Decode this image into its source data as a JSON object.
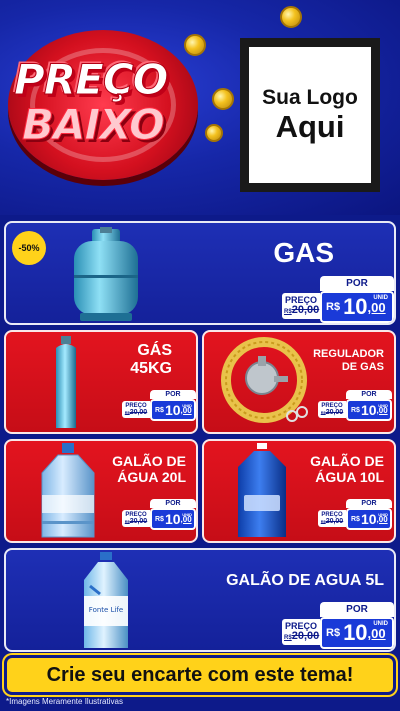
{
  "header": {
    "title_line1": "PREÇO",
    "title_line2": "BAIXO",
    "logo_line1": "Sua Logo",
    "logo_line2": "Aqui"
  },
  "colors": {
    "background": "#0d1a8a",
    "card_blue": "#1e2fb5",
    "card_red": "#e3141f",
    "accent_yellow": "#ffd21a",
    "price_blue": "#1a3ad8"
  },
  "products": [
    {
      "name": "GAS",
      "badge": "-50%",
      "old_label": "PREÇO",
      "old_price": "R$20,00",
      "old_cur": "R$",
      "old_val": "20,00",
      "por": "POR",
      "currency": "R$",
      "price_int": "10",
      "price_dec": ",00",
      "unit": "UNID",
      "icon": "gas-cylinder-icon"
    },
    {
      "name": "GÁS\n45KG",
      "old_label": "PREÇO",
      "old_cur": "R$",
      "old_val": "20,00",
      "por": "POR",
      "currency": "R$",
      "price_int": "10",
      "price_dec": ",00",
      "unit": "UNID",
      "icon": "tall-gas-cylinder-icon"
    },
    {
      "name": "REGULADOR\nDE GAS",
      "old_label": "PREÇO",
      "old_cur": "R$",
      "old_val": "20,00",
      "por": "POR",
      "currency": "R$",
      "price_int": "10",
      "price_dec": ",00",
      "unit": "UNID",
      "icon": "gas-regulator-icon"
    },
    {
      "name": "GALÃO DE\nÁGUA 20L",
      "old_label": "PREÇO",
      "old_cur": "R$",
      "old_val": "20,00",
      "por": "POR",
      "currency": "R$",
      "price_int": "10",
      "price_dec": ",00",
      "unit": "UNID",
      "icon": "water-jug-20l-icon"
    },
    {
      "name": "GALÃO DE\nÁGUA 10L",
      "old_label": "PREÇO",
      "old_cur": "R$",
      "old_val": "20,00",
      "por": "POR",
      "currency": "R$",
      "price_int": "10",
      "price_dec": ",00",
      "unit": "UNID",
      "icon": "water-jug-10l-icon"
    },
    {
      "name": "GALÃO DE AGUA 5L",
      "old_label": "PREÇO",
      "old_cur": "R$",
      "old_val": "20,00",
      "por": "POR",
      "currency": "R$",
      "price_int": "10",
      "price_dec": ",00",
      "unit": "UNID",
      "icon": "water-bottle-5l-icon",
      "bottle_label": "Fonte Life"
    }
  ],
  "footer": {
    "cta": "Crie seu encarte com este tema!",
    "disclaimer": "*Imagens Meramente Ilustrativas"
  }
}
